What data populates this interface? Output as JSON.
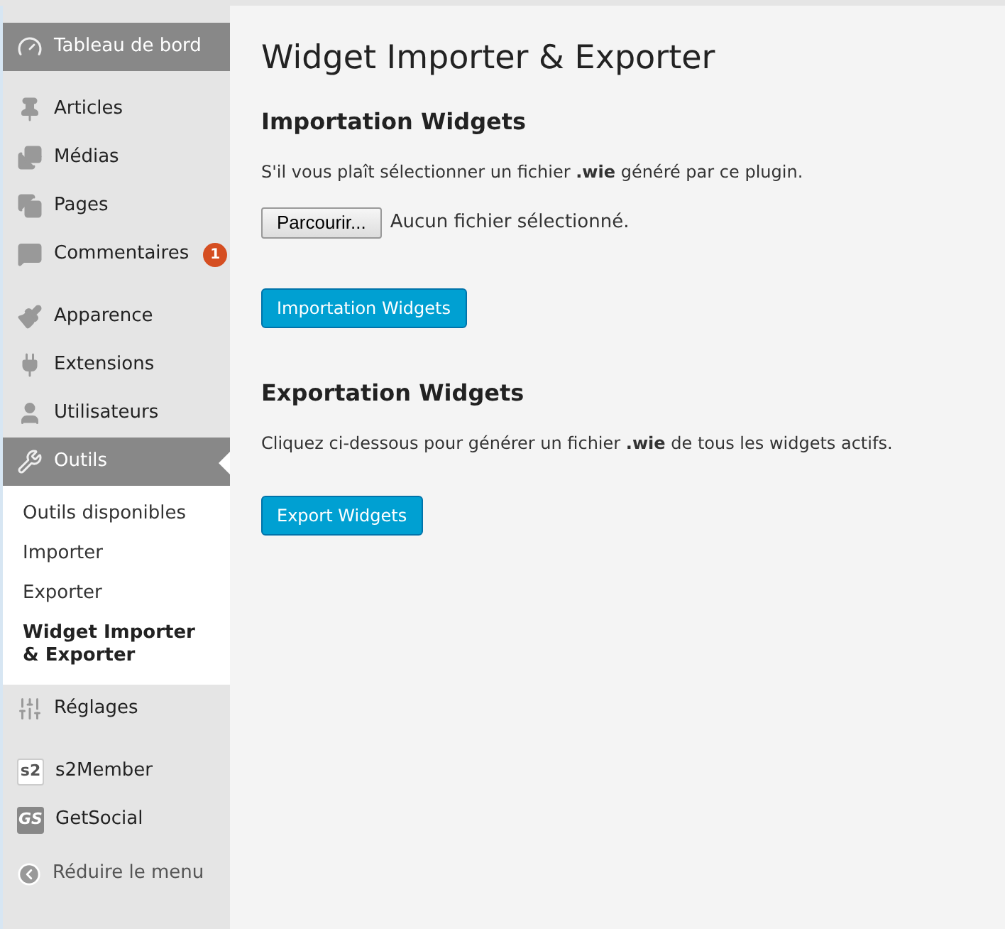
{
  "sidebar": {
    "groups": [
      [
        {
          "label": "Tableau de bord",
          "selected": true
        }
      ],
      [
        {
          "label": "Articles",
          "selected": false
        },
        {
          "label": "Médias",
          "selected": false
        },
        {
          "label": "Pages",
          "selected": false
        },
        {
          "label": "Commentaires",
          "selected": false,
          "badge": "1"
        }
      ],
      [
        {
          "label": "Apparence",
          "selected": false
        },
        {
          "label": "Extensions",
          "selected": false
        },
        {
          "label": "Utilisateurs",
          "selected": false
        },
        {
          "label": "Outils",
          "selected": true,
          "submenu": [
            {
              "label": "Outils disponibles",
              "selected": false
            },
            {
              "label": "Importer",
              "selected": false
            },
            {
              "label": "Exporter",
              "selected": false
            },
            {
              "label": "Widget Importer & Exporter",
              "selected": true
            }
          ]
        },
        {
          "label": "Réglages",
          "selected": false
        }
      ],
      [
        {
          "label": "s2Member",
          "selected": false,
          "icon_text": "s2"
        },
        {
          "label": "GetSocial",
          "selected": false,
          "icon_text": "GS"
        }
      ]
    ],
    "collapse": "Réduire le menu"
  },
  "main": {
    "title": "Widget Importer & Exporter",
    "import": {
      "heading": "Importation Widgets",
      "text": "S'il vous plaît sélectionner un fichier **.wie** généré par ce plugin.",
      "file_button": "Parcourir...",
      "file_status": "Aucun fichier sélectionné.",
      "button": "Importation Widgets"
    },
    "export": {
      "heading": "Exportation Widgets",
      "text": "Cliquez ci-dessous pour générer un fichier **.wie** de tous les widgets actifs.",
      "button": "Export Widgets"
    }
  }
}
